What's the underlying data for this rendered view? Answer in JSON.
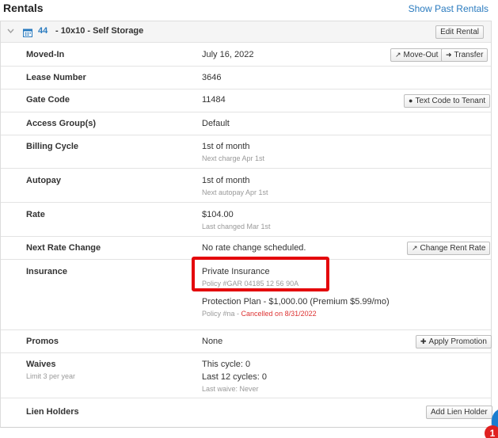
{
  "header": {
    "title": "Rentals",
    "show_past_link": "Show Past Rentals"
  },
  "rental": {
    "unit_number": "44",
    "unit_description": "- 10x10 - Self Storage",
    "edit_button": "Edit Rental",
    "icons": {
      "collapse": "chevron-down-icon",
      "unit": "calendar-icon"
    },
    "rows": {
      "moved_in": {
        "label": "Moved-In",
        "value": "July 16, 2022",
        "move_out_button": "Move-Out",
        "transfer_button": "Transfer"
      },
      "lease_number": {
        "label": "Lease Number",
        "value": "3646"
      },
      "gate_code": {
        "label": "Gate Code",
        "value": "11484",
        "text_code_button": "Text Code to Tenant"
      },
      "access_group": {
        "label": "Access Group(s)",
        "value": "Default"
      },
      "billing_cycle": {
        "label": "Billing Cycle",
        "value": "1st of month",
        "sub": "Next charge Apr 1st"
      },
      "autopay": {
        "label": "Autopay",
        "value": "1st of month",
        "sub": "Next autopay Apr 1st"
      },
      "rate": {
        "label": "Rate",
        "value": "$104.00",
        "sub": "Last changed Mar 1st"
      },
      "next_rate_change": {
        "label": "Next Rate Change",
        "value": "No rate change scheduled.",
        "change_rate_button": "Change Rent Rate"
      },
      "insurance": {
        "label": "Insurance",
        "private_value": "Private Insurance",
        "private_sub": "Policy #GAR 04185 12 56 90A",
        "protection_value": "Protection Plan - $1,000.00 (Premium $5.99/mo)",
        "protection_sub_prefix": "Policy #na - ",
        "protection_sub_status": "Cancelled on 8/31/2022"
      },
      "promos": {
        "label": "Promos",
        "value": "None",
        "apply_button": "Apply Promotion"
      },
      "waives": {
        "label": "Waives",
        "sublabel": "Limit 3 per year",
        "value1": "This cycle: 0",
        "value2": "Last 12 cycles: 0",
        "sub": "Last waive: Never"
      },
      "lien_holders": {
        "label": "Lien Holders",
        "add_button": "Add Lien Holder"
      }
    }
  },
  "notification": {
    "count": "1"
  },
  "colors": {
    "link": "#2a7bbf",
    "highlight": "#e4070b",
    "cancelled": "#d33333",
    "notification": "#e02020"
  }
}
